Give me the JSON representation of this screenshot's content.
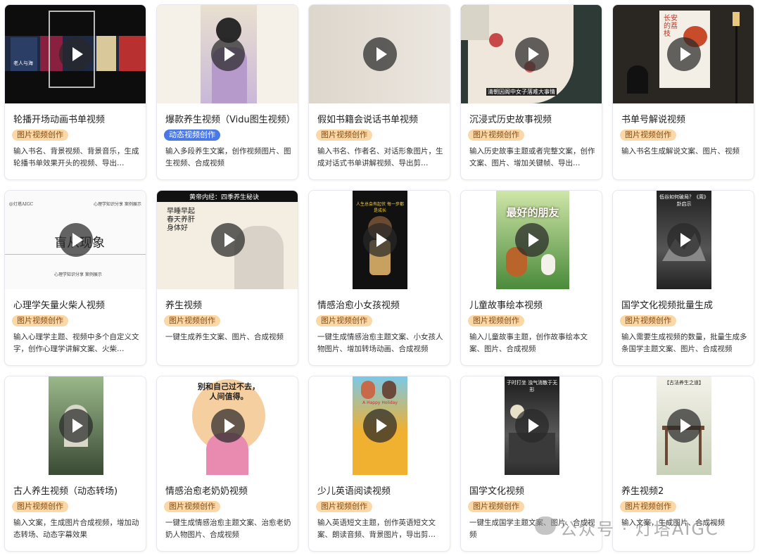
{
  "cards": [
    {
      "title": "轮播开场动画书单视频",
      "tag": "图片视频创作",
      "desc": "输入书名、背景视频、背景音乐，生成轮播书单效果开头的视频、导出…",
      "thumb_text": "老人与海"
    },
    {
      "title": "爆款养生视频（Vidu图生视频）",
      "tag": "动态视频创作",
      "desc": "输入多段养生文案，创作视频图片、图生视频、合成视频"
    },
    {
      "title": "假如书籍会说话书单视频",
      "tag": "图片视频创作",
      "desc": "输入书名、作者名、对话形象图片，生成对话式书单讲解视频、导出剪…"
    },
    {
      "title": "沉浸式历史故事视频",
      "tag": "图片视频创作",
      "desc": "输入历史故事主题或者完整文案，创作文案、图片、增加关键帧、导出…",
      "thumb_text": "清朝因阁中女子落难大事情"
    },
    {
      "title": "书单号解说视频",
      "tag": "图片视频创作",
      "desc": "输入书名生成解说文案、图片、视频",
      "thumb_text": "长安的荔枝"
    },
    {
      "title": "心理学矢量火柴人视频",
      "tag": "图片视频创作",
      "desc": "输入心理学主题、视频中多个自定义文字，创作心理学讲解文案、火柴…",
      "thumb_text": "盲从现象",
      "thumb_top_left": "@灯塔AIGC",
      "thumb_top_right": "心理学知识分享 案例展示",
      "thumb_bottom": "心理学知识分享 案例展示"
    },
    {
      "title": "养生视频",
      "tag": "图片视频创作",
      "desc": "一键生成养生文案、图片、合成视频",
      "thumb_text": "黄帝内经：四季养生秘诀",
      "thumb_poem": "早睡早起 春天养肝 身体好"
    },
    {
      "title": "情感治愈小女孩视频",
      "tag": "图片视频创作",
      "desc": "一键生成情感治愈主题文案、小女孩人物图片、增加转场动画、合成视频",
      "thumb_text": "人生总会有起伏 每一步都是成长"
    },
    {
      "title": "儿童故事绘本视频",
      "tag": "图片视频创作",
      "desc": "输入儿童故事主题，创作故事绘本文案、图片、合成视频",
      "thumb_text": "最好的朋友"
    },
    {
      "title": "国学文化视频批量生成",
      "tag": "图片视频创作",
      "desc": "输入需要生成视频的数量，批量生成多条国学主题文案、图片、合成视频",
      "thumb_text": "低谷如何破局？《周》卦启示"
    },
    {
      "title": "古人养生视频（动态转场)",
      "tag": "图片视频创作",
      "desc": "输入文案，生成图片合成视频，增加动态转场、动态字幕效果"
    },
    {
      "title": "情感治愈老奶奶视频",
      "tag": "图片视频创作",
      "desc": "一键生成情感治愈主题文案、治愈老奶奶人物图片、合成视频",
      "thumb_text": "别和自己过不去，人间值得。"
    },
    {
      "title": "少儿英语阅读视频",
      "tag": "图片视频创作",
      "desc": "输入英语短文主题，创作英语短文文案、朗读音频、背景图片，导出剪…",
      "thumb_text": "A Happy Holiday"
    },
    {
      "title": "国学文化视频",
      "tag": "图片视频创作",
      "desc": "一键生成国学主题文案、图片、合成视频",
      "thumb_text": "子时打坐 浊气消散于无形"
    },
    {
      "title": "养生视频2",
      "tag": "图片视频创作",
      "desc": "输入文案，生成图片、合成视频",
      "thumb_text": "【古法养生之道】"
    }
  ],
  "tag_types": [
    "orange",
    "blue",
    "orange",
    "orange",
    "orange",
    "orange",
    "orange",
    "orange",
    "orange",
    "orange",
    "orange",
    "orange",
    "orange",
    "orange",
    "orange"
  ],
  "watermark": "公众号 · 灯塔AIGC"
}
